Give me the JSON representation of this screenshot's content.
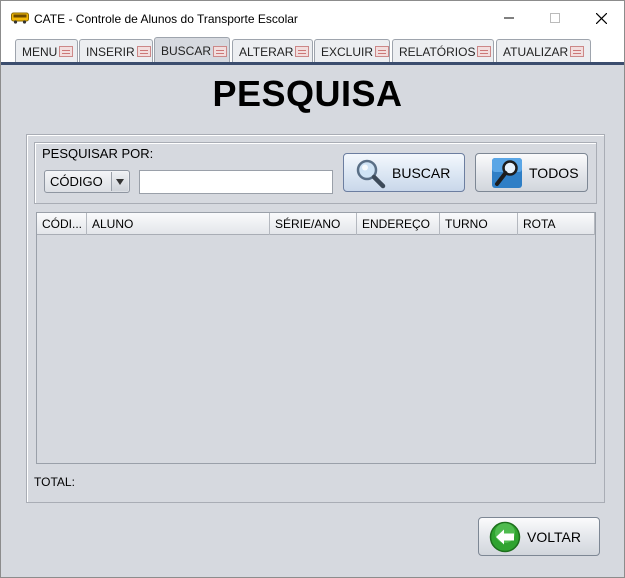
{
  "window": {
    "title": "CATE - Controle de Alunos do Transporte Escolar"
  },
  "tabs": [
    {
      "label": "MENU"
    },
    {
      "label": "INSERIR"
    },
    {
      "label": "BUSCAR"
    },
    {
      "label": "ALTERAR"
    },
    {
      "label": "EXCLUIR"
    },
    {
      "label": "RELATÓRIOS"
    },
    {
      "label": "ATUALIZAR"
    }
  ],
  "page": {
    "title": "PESQUISA"
  },
  "search": {
    "label": "PESQUISAR POR:",
    "field_selected": "CÓDIGO",
    "input_value": "",
    "buscar_label": "BUSCAR",
    "todos_label": "TODOS"
  },
  "table": {
    "columns": [
      "CÓDI...",
      "ALUNO",
      "SÉRIE/ANO",
      "ENDEREÇO",
      "TURNO",
      "ROTA"
    ],
    "rows": []
  },
  "footer": {
    "total_label": "TOTAL:",
    "voltar_label": "VOLTAR"
  },
  "colors": {
    "tab_underline": "#3b4d6e",
    "background": "#d6d9df",
    "voltar_icon": "#2fa32f"
  },
  "icons": [
    "bus-icon",
    "magnifier-icon",
    "search-doc-icon",
    "back-arrow-icon"
  ]
}
